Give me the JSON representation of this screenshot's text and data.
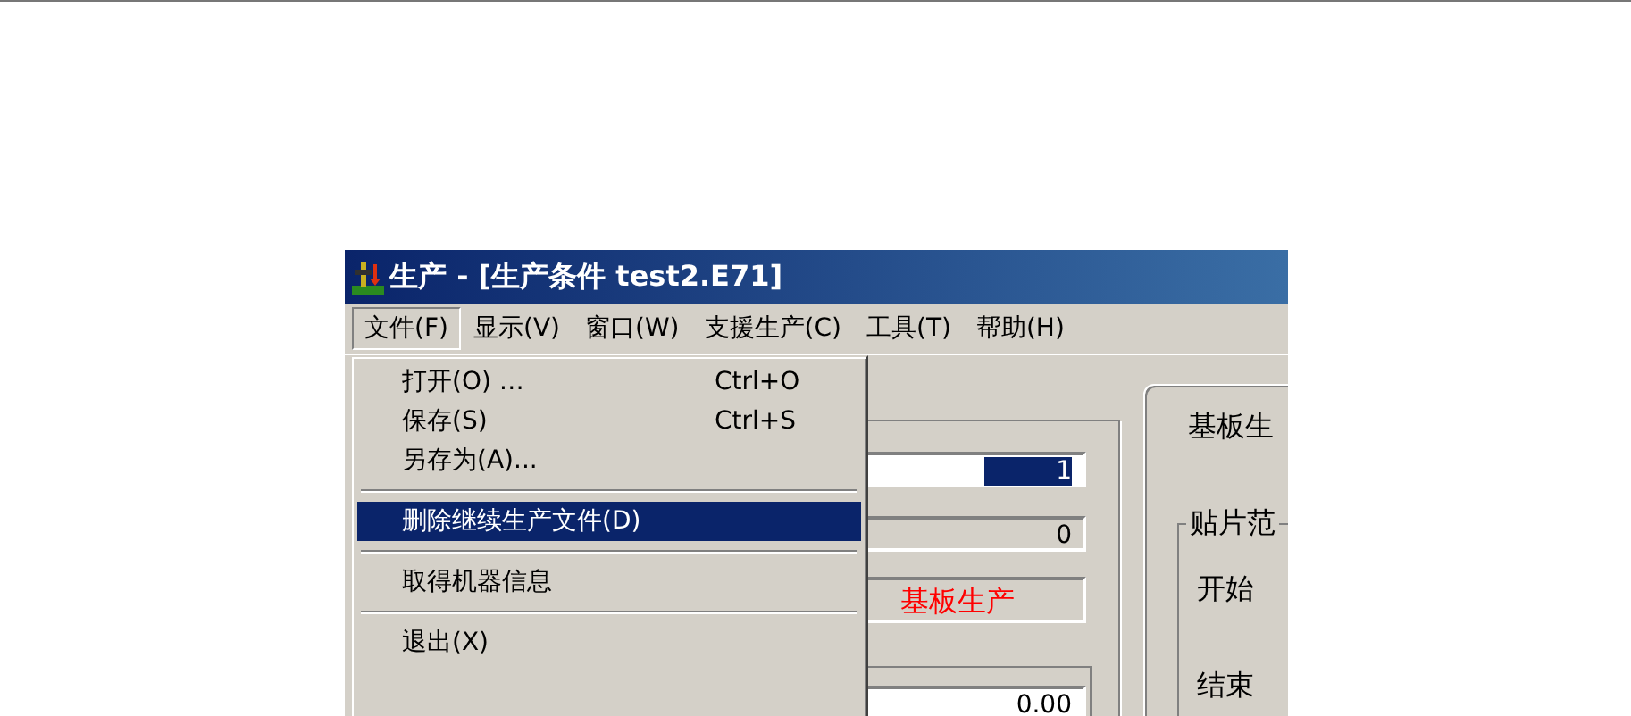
{
  "window": {
    "title": "生产 - [生产条件 test2.E71]"
  },
  "menu_bar": [
    {
      "label": "文件(F)",
      "selected": true
    },
    {
      "label": "显示(V)",
      "selected": false
    },
    {
      "label": "窗口(W)",
      "selected": false
    },
    {
      "label": "支援生产(C)",
      "selected": false
    },
    {
      "label": "工具(T)",
      "selected": false
    },
    {
      "label": "帮助(H)",
      "selected": false
    }
  ],
  "file_menu": [
    {
      "kind": "item",
      "label": "打开(O) …",
      "shortcut": "Ctrl+O",
      "selected": false
    },
    {
      "kind": "item",
      "label": "保存(S)",
      "shortcut": "Ctrl+S",
      "selected": false
    },
    {
      "kind": "item",
      "label": "另存为(A)...",
      "selected": false
    },
    {
      "kind": "separator"
    },
    {
      "kind": "item",
      "label": "删除继续生产文件(D)",
      "selected": true
    },
    {
      "kind": "separator"
    },
    {
      "kind": "item",
      "label": "取得机器信息",
      "selected": false
    },
    {
      "kind": "separator"
    },
    {
      "kind": "item",
      "label": "退出(X)",
      "selected": false
    }
  ],
  "left_panel": {
    "count_field": "1",
    "produced_field": "0",
    "status": "基板生产",
    "time_field": "0.00"
  },
  "right_panel": {
    "title": "基板生",
    "group_title": "贴片范",
    "start_label": "开始",
    "end_label": "结束"
  }
}
